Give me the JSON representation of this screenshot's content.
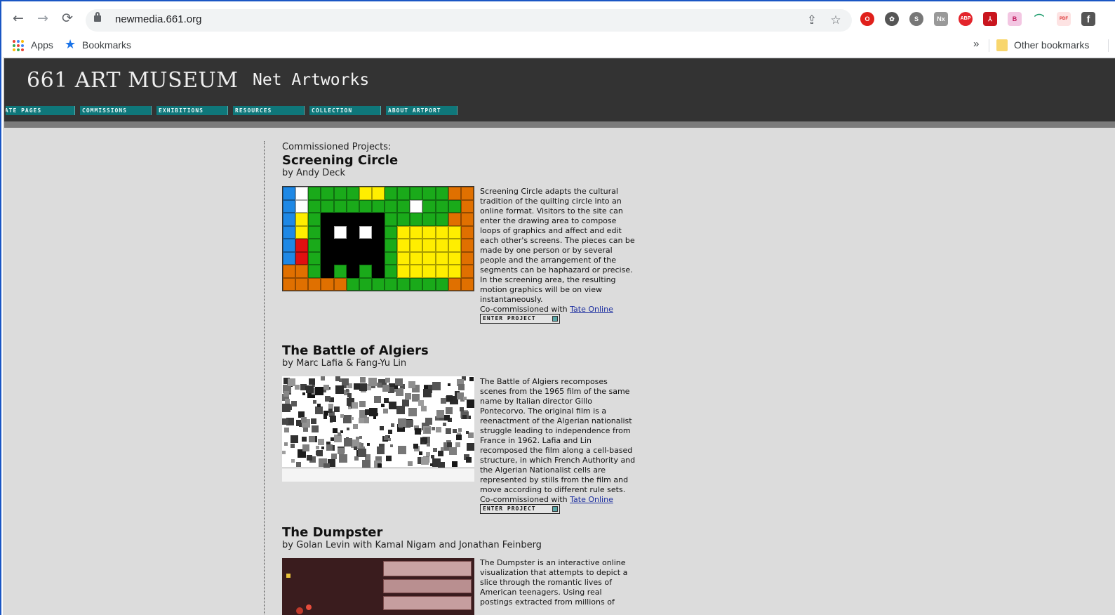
{
  "browser": {
    "url": "newmedia.661.org",
    "nav": {
      "back": "←",
      "forward": "→",
      "reload": "⟳"
    },
    "bookmarks": {
      "apps": "Apps",
      "bookmarks": "Bookmarks",
      "overflow": "»",
      "other": "Other bookmarks"
    },
    "extensions": [
      "opera-icon",
      "reel-icon",
      "skype-icon",
      "nx-icon",
      "adblock-icon",
      "pdf-icon",
      "b-icon",
      "arc-icon",
      "pdf2-icon",
      "facebook-icon"
    ],
    "extension_labels": {
      "nx": "Nx",
      "adblock": "ABP",
      "b": "B",
      "pdf2": "PDF",
      "facebook": "f"
    }
  },
  "site": {
    "logo": "661 ART MUSEUM",
    "subtitle": "Net Artworks",
    "menu": [
      "GATE PAGES",
      "COMMISSIONS",
      "EXHIBITIONS",
      "RESOURCES",
      "COLLECTION",
      "ABOUT ARTPORT"
    ]
  },
  "page": {
    "kicker": "Commissioned Projects:",
    "projects": [
      {
        "title": "Screening Circle",
        "byline": "by Andy Deck",
        "description": "Screening Circle adapts the cultural tradition of the quilting circle into an online format. Visitors to the site can enter the drawing area to compose loops of graphics and affect and edit each other's screens. The pieces can be made by one person or by several people and the arrangement of the segments can be haphazard or precise. In the screening area, the resulting motion graphics will be on view instantaneously.",
        "cocommission_prefix": "Co-commissioned with ",
        "cocommission_link": "Tate Online",
        "enter": "ENTER PROJECT"
      },
      {
        "title": "The Battle of Algiers",
        "byline": "by Marc Lafia & Fang-Yu Lin",
        "description": "The Battle of Algiers recomposes scenes from the 1965 film of the same name by Italian director Gillo Pontecorvo. The original film is a reenactment of the Algerian nationalist struggle leading to independence from France in 1962. Lafia and Lin recomposed the film along a cell-based structure, in which French Authority and the Algerian Nationalist cells are represented by stills from the film and move according to different rule sets.",
        "cocommission_prefix": "Co-commissioned with ",
        "cocommission_link": "Tate Online",
        "enter": "ENTER PROJECT"
      },
      {
        "title": "The Dumpster",
        "byline": "by Golan Levin with Kamal Nigam and Jonathan Feinberg",
        "description": "The Dumpster is an interactive online visualization that attempts to depict a slice through the romantic lives of American teenagers. Using real postings extracted from millions of"
      }
    ]
  },
  "colors": {
    "header_bg": "#333333",
    "menu_tab": "#0f777a",
    "page_bg": "#dcdcdc",
    "link": "#1d2fa0"
  }
}
